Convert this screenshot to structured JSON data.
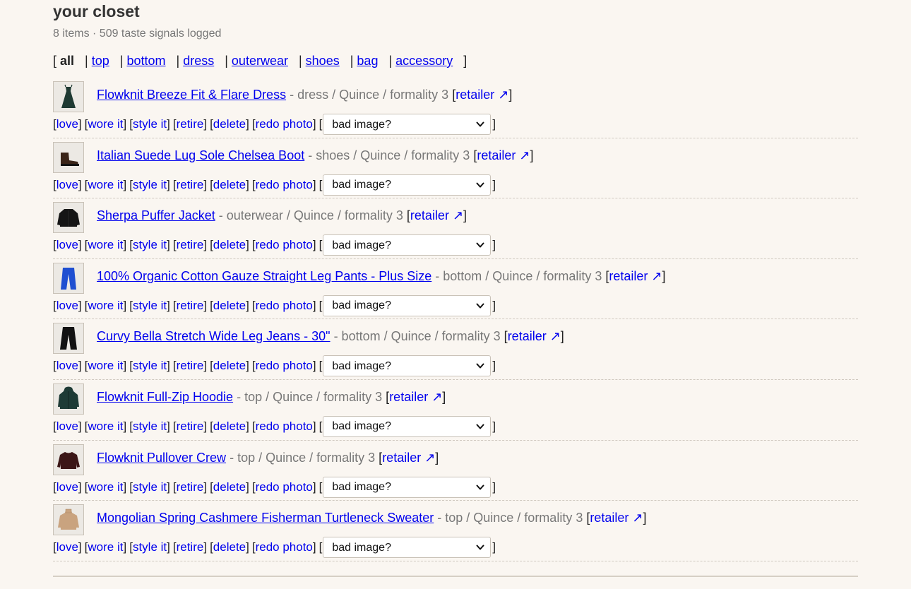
{
  "page": {
    "title": "your closet",
    "meta": "8 items · 509 taste signals logged"
  },
  "filters": {
    "current": "all",
    "links": [
      "top",
      "bottom",
      "dress",
      "outerwear",
      "shoes",
      "bag",
      "accessory"
    ]
  },
  "actions": {
    "love": "love",
    "wore_it": "wore it",
    "style_it": "style it",
    "retire": "retire",
    "delete": "delete",
    "redo_photo": "redo photo",
    "bad_image_placeholder": "bad image?",
    "retailer": "retailer ↗"
  },
  "items": [
    {
      "name": "Flowknit Breeze Fit & Flare Dress",
      "category": "dress",
      "brand": "Quince",
      "formality": "formality 3",
      "meta": "- dress / Quince / formality 3",
      "icon": "dress-icon",
      "thumb_color": "#1f3a33"
    },
    {
      "name": "Italian Suede Lug Sole Chelsea Boot",
      "category": "shoes",
      "brand": "Quince",
      "formality": "formality 3",
      "meta": "- shoes / Quince / formality 3",
      "icon": "boot-icon",
      "thumb_color": "#3a2418"
    },
    {
      "name": "Sherpa Puffer Jacket",
      "category": "outerwear",
      "brand": "Quince",
      "formality": "formality 3",
      "meta": "- outerwear / Quince / formality 3",
      "icon": "jacket-icon",
      "thumb_color": "#151515"
    },
    {
      "name": "100% Organic Cotton Gauze Straight Leg Pants - Plus Size",
      "category": "bottom",
      "brand": "Quince",
      "formality": "formality 3",
      "meta": "- bottom / Quince / formality 3",
      "icon": "pants-icon",
      "thumb_color": "#1f4fd1"
    },
    {
      "name": "Curvy Bella Stretch Wide Leg Jeans - 30\"",
      "category": "bottom",
      "brand": "Quince",
      "formality": "formality 3",
      "meta": "- bottom / Quince / formality 3",
      "icon": "jeans-icon",
      "thumb_color": "#121212"
    },
    {
      "name": "Flowknit Full-Zip Hoodie",
      "category": "top",
      "brand": "Quince",
      "formality": "formality 3",
      "meta": "- top / Quince / formality 3",
      "icon": "hoodie-icon",
      "thumb_color": "#1e3b36"
    },
    {
      "name": "Flowknit Pullover Crew",
      "category": "top",
      "brand": "Quince",
      "formality": "formality 3",
      "meta": "- top / Quince / formality 3",
      "icon": "sweatshirt-icon",
      "thumb_color": "#3b1616"
    },
    {
      "name": "Mongolian Spring Cashmere Fisherman Turtleneck Sweater",
      "category": "top",
      "brand": "Quince",
      "formality": "formality 3",
      "meta": "- top / Quince / formality 3",
      "icon": "sweater-icon",
      "thumb_color": "#c9a37f"
    }
  ]
}
